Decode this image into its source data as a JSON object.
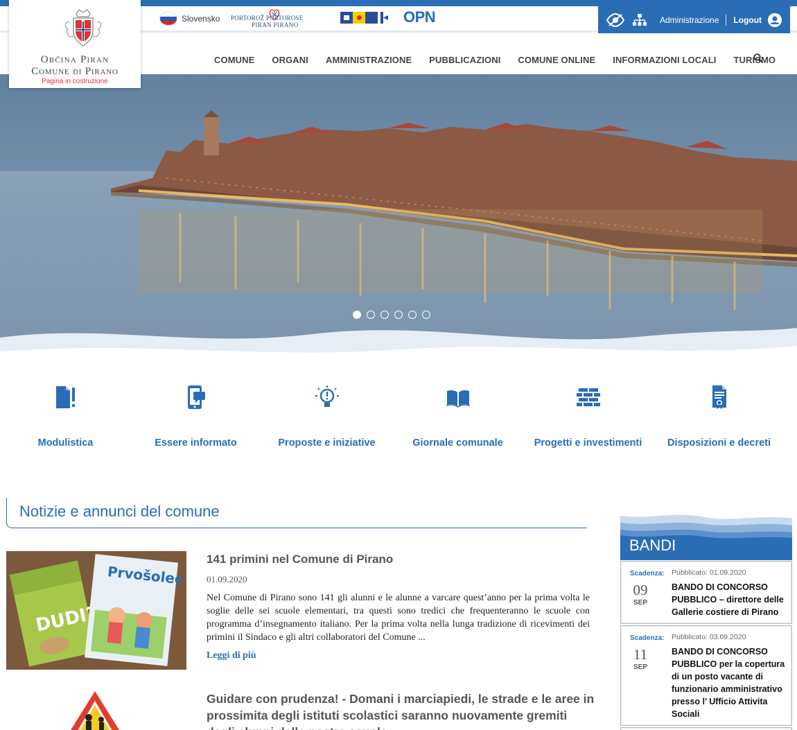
{
  "topbar": {
    "language": "Slovensko",
    "portoroz_logo": {
      "line1": "PORTOROŽ   PORTOROSE",
      "line2": "PIRAN   PIRANO"
    },
    "opn_logo": "OPN",
    "admin_label": "Administrazione",
    "logout_label": "Logout"
  },
  "logo": {
    "line1": "Občina Piran",
    "line2": "Comune di Pirano",
    "note": "Pagina in costruzione"
  },
  "nav": {
    "items": [
      "COMUNE",
      "ORGANI",
      "AMMINISTRAZIONE",
      "PUBBLICAZIONI",
      "COMUNE ONLINE",
      "INFORMAZIONI LOCALI",
      "TURISMO"
    ]
  },
  "slider": {
    "dots_total": 6,
    "active_index": 0
  },
  "quick_links": [
    {
      "label": "Modulistica",
      "icon": "document-alert-icon"
    },
    {
      "label": "Essere informato",
      "icon": "mobile-info-icon"
    },
    {
      "label": "Proposte e iniziative",
      "icon": "lightbulb-icon"
    },
    {
      "label": "Giornale comunale",
      "icon": "open-book-icon"
    },
    {
      "label": "Progetti e investimenti",
      "icon": "brick-wall-icon"
    },
    {
      "label": "Disposizioni e decreti",
      "icon": "document-seal-icon"
    }
  ],
  "news": {
    "heading": "Notizie e annunci del comune",
    "items": [
      {
        "title": "141 primini nel Comune di Pirano",
        "date": "01.09.2020",
        "body": "Nel Comune di Pirano sono 141 gli alunni e le alunne a varcare quest’anno per la prima volta le soglie delle sei scuole elementari, tra questi sono tredici che frequenteranno le scuole con programma d’insegnamento italiano. Per la prima volta nella lunga tradizione di ricevimenti dei primini il Sindaco e gli altri collaboratori del Comune ...",
        "more": "Leggi di più"
      },
      {
        "title": "Guidare con prudenza! - Domani i marciapiedi, le strade e le aree in prossimita degli istituti scolastici saranno nuovamente gremiti dagli alunni delle nostre scuole"
      }
    ]
  },
  "bandi": {
    "heading": "BANDI",
    "items": [
      {
        "scadenza_label": "Scadenza:",
        "day": "09",
        "month": "SEP",
        "published": "Pubblicato: 01.09.2020",
        "title": "BANDO DI CONCORSO PUBBLICO – direttore delle Gallerie costiere di Pirano"
      },
      {
        "scadenza_label": "Scadenza:",
        "day": "11",
        "month": "SEP",
        "published": "Pubblicato: 03.09.2020",
        "title": "BANDO DI CONCORSO PUBBLICO per la copertura di un posto vacante di funzionario amministrativo presso l’ Ufficio Attivita Sociali"
      }
    ]
  },
  "colors": {
    "accent": "#2a6db5",
    "note_red": "#d33333"
  }
}
